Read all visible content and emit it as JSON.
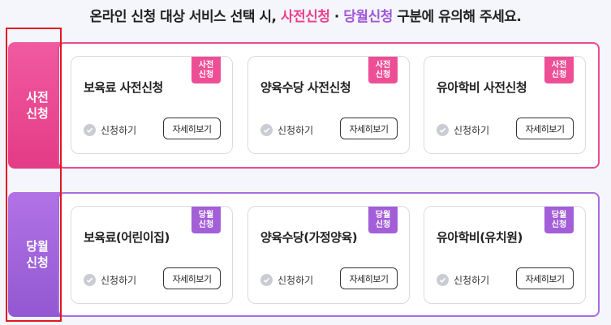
{
  "headline": {
    "prefix": "온라인 신청 대상 서비스 선택 시, ",
    "highlight_pre": "사전신청",
    "separator": " · ",
    "highlight_now": "당월신청",
    "suffix": " 구분에 유의해 주세요."
  },
  "sections": [
    {
      "label": "사전\n신청",
      "badge": "사전\n신청",
      "cards": [
        {
          "title": "보육료 사전신청",
          "apply": "신청하기",
          "detail": "자세히보기"
        },
        {
          "title": "양육수당 사전신청",
          "apply": "신청하기",
          "detail": "자세히보기"
        },
        {
          "title": "유아학비 사전신청",
          "apply": "신청하기",
          "detail": "자세히보기"
        }
      ]
    },
    {
      "label": "당월\n신청",
      "badge": "당월\n신청",
      "cards": [
        {
          "title": "보육료(어린이집)",
          "apply": "신청하기",
          "detail": "자세히보기"
        },
        {
          "title": "양육수당(가정양육)",
          "apply": "신청하기",
          "detail": "자세히보기"
        },
        {
          "title": "유아학비(유치원)",
          "apply": "신청하기",
          "detail": "자세히보기"
        }
      ]
    }
  ],
  "colors": {
    "pink": "#ec3f8c",
    "purple": "#a157d7",
    "highlight_outline": "#e3161f"
  }
}
